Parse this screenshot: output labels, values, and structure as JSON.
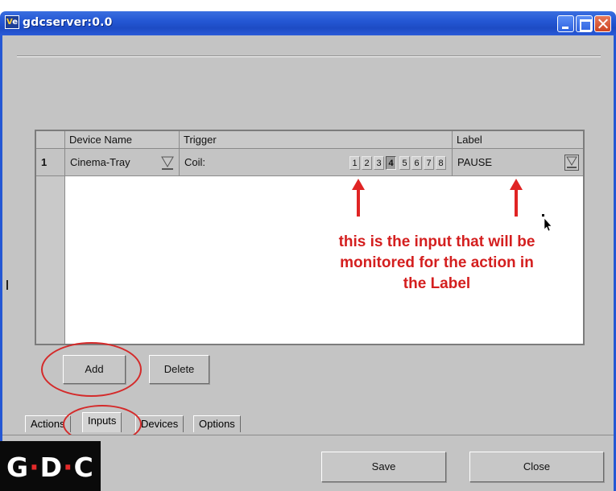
{
  "window": {
    "title": "gdcserver:0.0",
    "icon_label": "V",
    "icon_label_2": "e"
  },
  "table": {
    "headers": [
      "Device Name",
      "Trigger",
      "Label"
    ],
    "rows": [
      {
        "index": "1",
        "device_name": "Cinema-Tray",
        "trigger_type": "Coil:",
        "coils": [
          "1",
          "2",
          "3",
          "4",
          "5",
          "6",
          "7",
          "8"
        ],
        "selected_coil": "4",
        "label": "PAUSE"
      }
    ]
  },
  "annotation": {
    "line1": "this is the input that will be",
    "line2": "monitored for the action in",
    "line3": "the Label",
    "color": "#d41f1f"
  },
  "buttons": {
    "add": "Add",
    "delete": "Delete",
    "save": "Save",
    "close": "Close"
  },
  "tabs": {
    "actions": "Actions",
    "inputs": "Inputs",
    "devices": "Devices",
    "options": "Options",
    "active": "Inputs"
  },
  "logo": {
    "letter1": "G",
    "dot": "·",
    "letter2": "D",
    "letter3": "C"
  }
}
